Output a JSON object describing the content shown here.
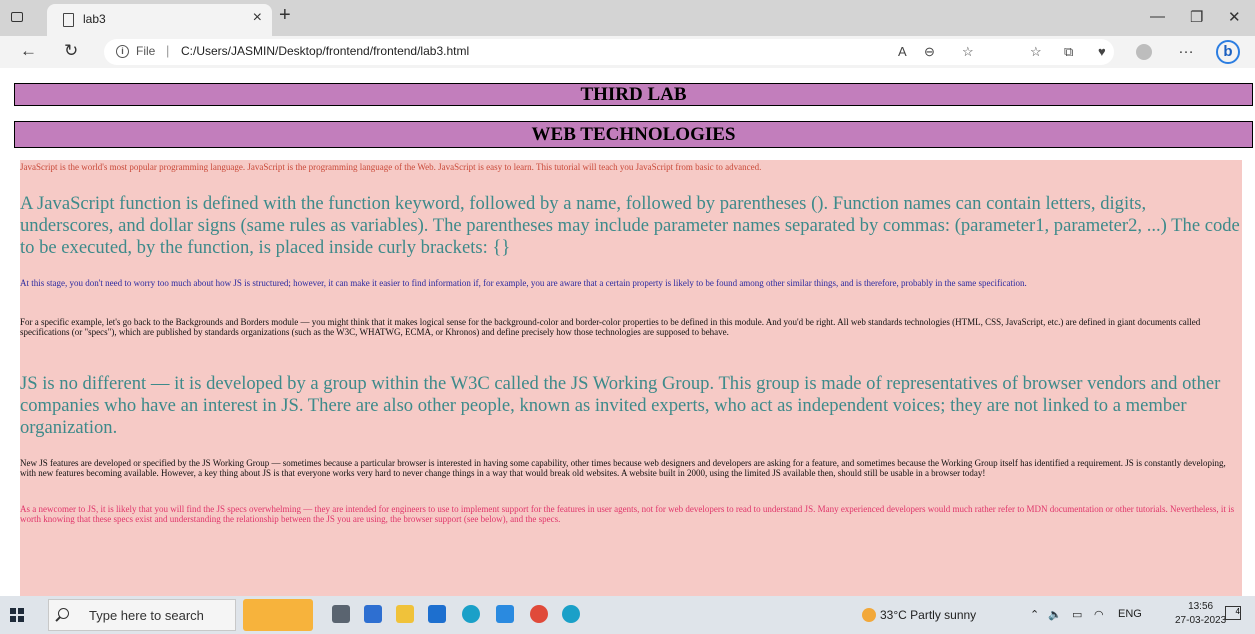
{
  "browser": {
    "tab_title": "lab3",
    "new_tab_glyph": "+",
    "close_glyph": "×",
    "address_label": "File",
    "url": "C:/Users/JASMIN/Desktop/frontend/frontend/lab3.html"
  },
  "page": {
    "heading1": "THIRD LAB",
    "heading2": "WEB TECHNOLOGIES",
    "paragraphs": [
      "JavaScript is the world's most popular programming language. JavaScript is the programming language of the Web. JavaScript is easy to learn. This tutorial will teach you JavaScript from basic to advanced.",
      "A JavaScript function is defined with the function keyword, followed by a name, followed by parentheses (). Function names can contain letters, digits, underscores, and dollar signs (same rules as variables). The parentheses may include parameter names separated by commas: (parameter1, parameter2, ...) The code to be executed, by the function, is placed inside curly brackets: {}",
      "At this stage, you don't need to worry too much about how JS is structured; however, it can make it easier to find information if, for example, you are aware that a certain property is likely to be found among other similar things, and is therefore, probably in the same specification.",
      "For a specific example, let's go back to the Backgrounds and Borders module — you might think that it makes logical sense for the background-color and border-color properties to be defined in this module. And you'd be right. All web standards technologies (HTML, CSS, JavaScript, etc.) are defined in giant documents called specifications (or \"specs\"), which are published by standards organizations (such as the W3C, WHATWG, ECMA, or Khronos) and define precisely how those technologies are supposed to behave.",
      "JS is no different — it is developed by a group within the W3C called the JS Working Group. This group is made of representatives of browser vendors and other companies who have an interest in JS. There are also other people, known as invited experts, who act as independent voices; they are not linked to a member organization.",
      "New JS features are developed or specified by the JS Working Group — sometimes because a particular browser is interested in having some capability, other times because web designers and developers are asking for a feature, and sometimes because the Working Group itself has identified a requirement. JS is constantly developing, with new features becoming available. However, a key thing about JS is that everyone works very hard to never change things in a way that would break old websites. A website built in 2000, using the limited JS available then, should still be usable in a browser today!",
      "As a newcomer to JS, it is likely that you will find the JS specs overwhelming — they are intended for engineers to use to implement support for the features in user agents, not for web developers to read to understand JS. Many experienced developers would much rather refer to MDN documentation or other tutorials. Nevertheless, it is worth knowing that these specs exist and understanding the relationship between the JS you are using, the browser support (see below), and the specs."
    ]
  },
  "taskbar": {
    "search_placeholder": "Type here to search",
    "weather": "33°C  Partly sunny",
    "language": "ENG",
    "time": "13:56",
    "date": "27-03-2023",
    "notification_count": "4"
  }
}
